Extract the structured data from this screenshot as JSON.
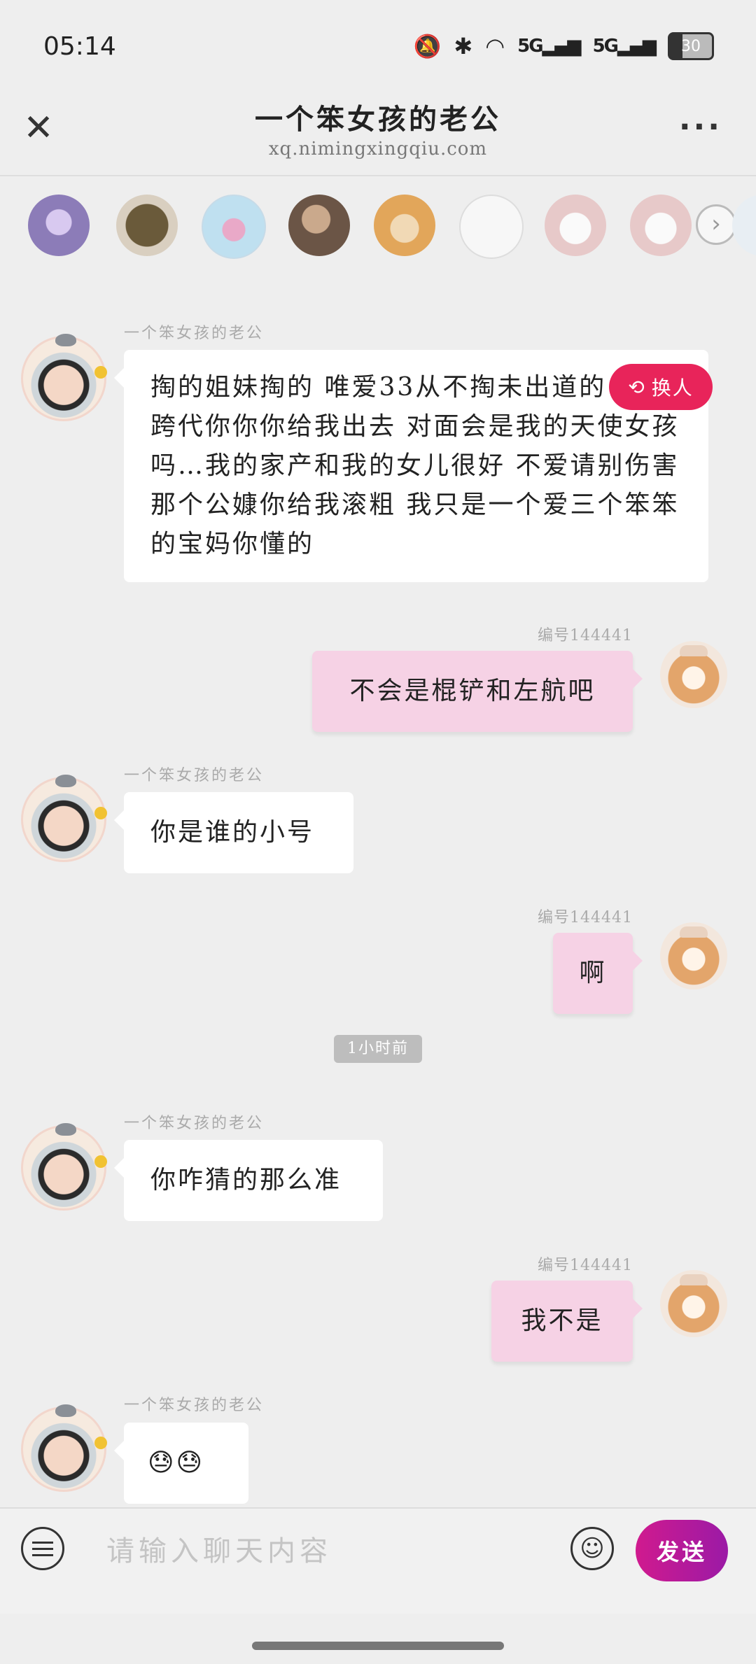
{
  "status_bar": {
    "time": "05:14",
    "network_1": "5G",
    "network_2": "5G",
    "battery": "30"
  },
  "header": {
    "title": "一个笨女孩的老公",
    "subtitle": "xq.nimingxingqiu.com"
  },
  "strip": {
    "next_icon": "chevron-right"
  },
  "swap_button": {
    "label": "换人"
  },
  "messages": {
    "m1": {
      "name": "一个笨女孩的老公",
      "text": "掏的姐妹掏的 唯爱33从不掏未出道的 那个跨代你你你给我出去 对面会是我的天使女孩吗…我的家产和我的女儿很好 不爱请别伤害 那个公嫝你给我滚粗 我只是一个爱三个笨笨的宝妈你懂的"
    },
    "m2": {
      "id": "编号144441",
      "text": "不会是棍铲和左航吧"
    },
    "m3": {
      "name": "一个笨女孩的老公",
      "text": "你是谁的小号"
    },
    "m4": {
      "id": "编号144441",
      "text": "啊"
    },
    "time_divider": "1小时前",
    "m5": {
      "name": "一个笨女孩的老公",
      "text": "你咋猜的那么准"
    },
    "m6": {
      "id": "编号144441",
      "text": "我不是"
    },
    "m7": {
      "name": "一个笨女孩的老公",
      "text": "😓😓"
    }
  },
  "composer": {
    "placeholder": "请输入聊天内容",
    "send_label": "发送"
  },
  "colors": {
    "accent": "#e8245a",
    "send_gradient_start": "#d01a8e",
    "send_gradient_end": "#9b1aa6",
    "outgoing_bubble": "#f6d2e5"
  }
}
